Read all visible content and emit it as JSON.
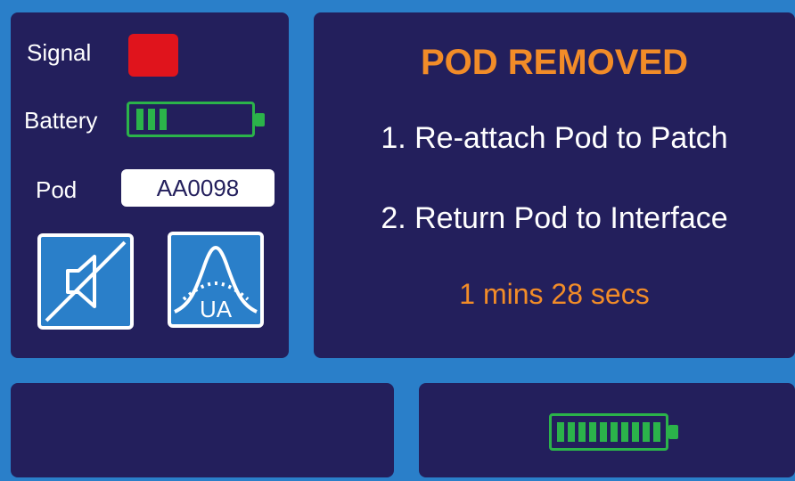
{
  "status": {
    "signal_label": "Signal",
    "signal_color": "#e0141c",
    "battery_label": "Battery",
    "battery_level": 0.3,
    "pod_label": "Pod",
    "pod_id": "AA0098",
    "mute_icon": "speaker-muted-icon",
    "ua_icon": "ua-curve-icon",
    "ua_text": "UA"
  },
  "alert": {
    "title": "POD REMOVED",
    "instruction_1": "1. Re-attach Pod to Patch",
    "instruction_2": "2. Return Pod to Interface",
    "countdown": "1 mins 28 secs"
  },
  "bottom": {
    "battery_level": 1.0
  },
  "colors": {
    "background": "#2a7fc9",
    "panel": "#231f5c",
    "accent_orange": "#f28c28",
    "battery_green": "#2bb34a"
  }
}
